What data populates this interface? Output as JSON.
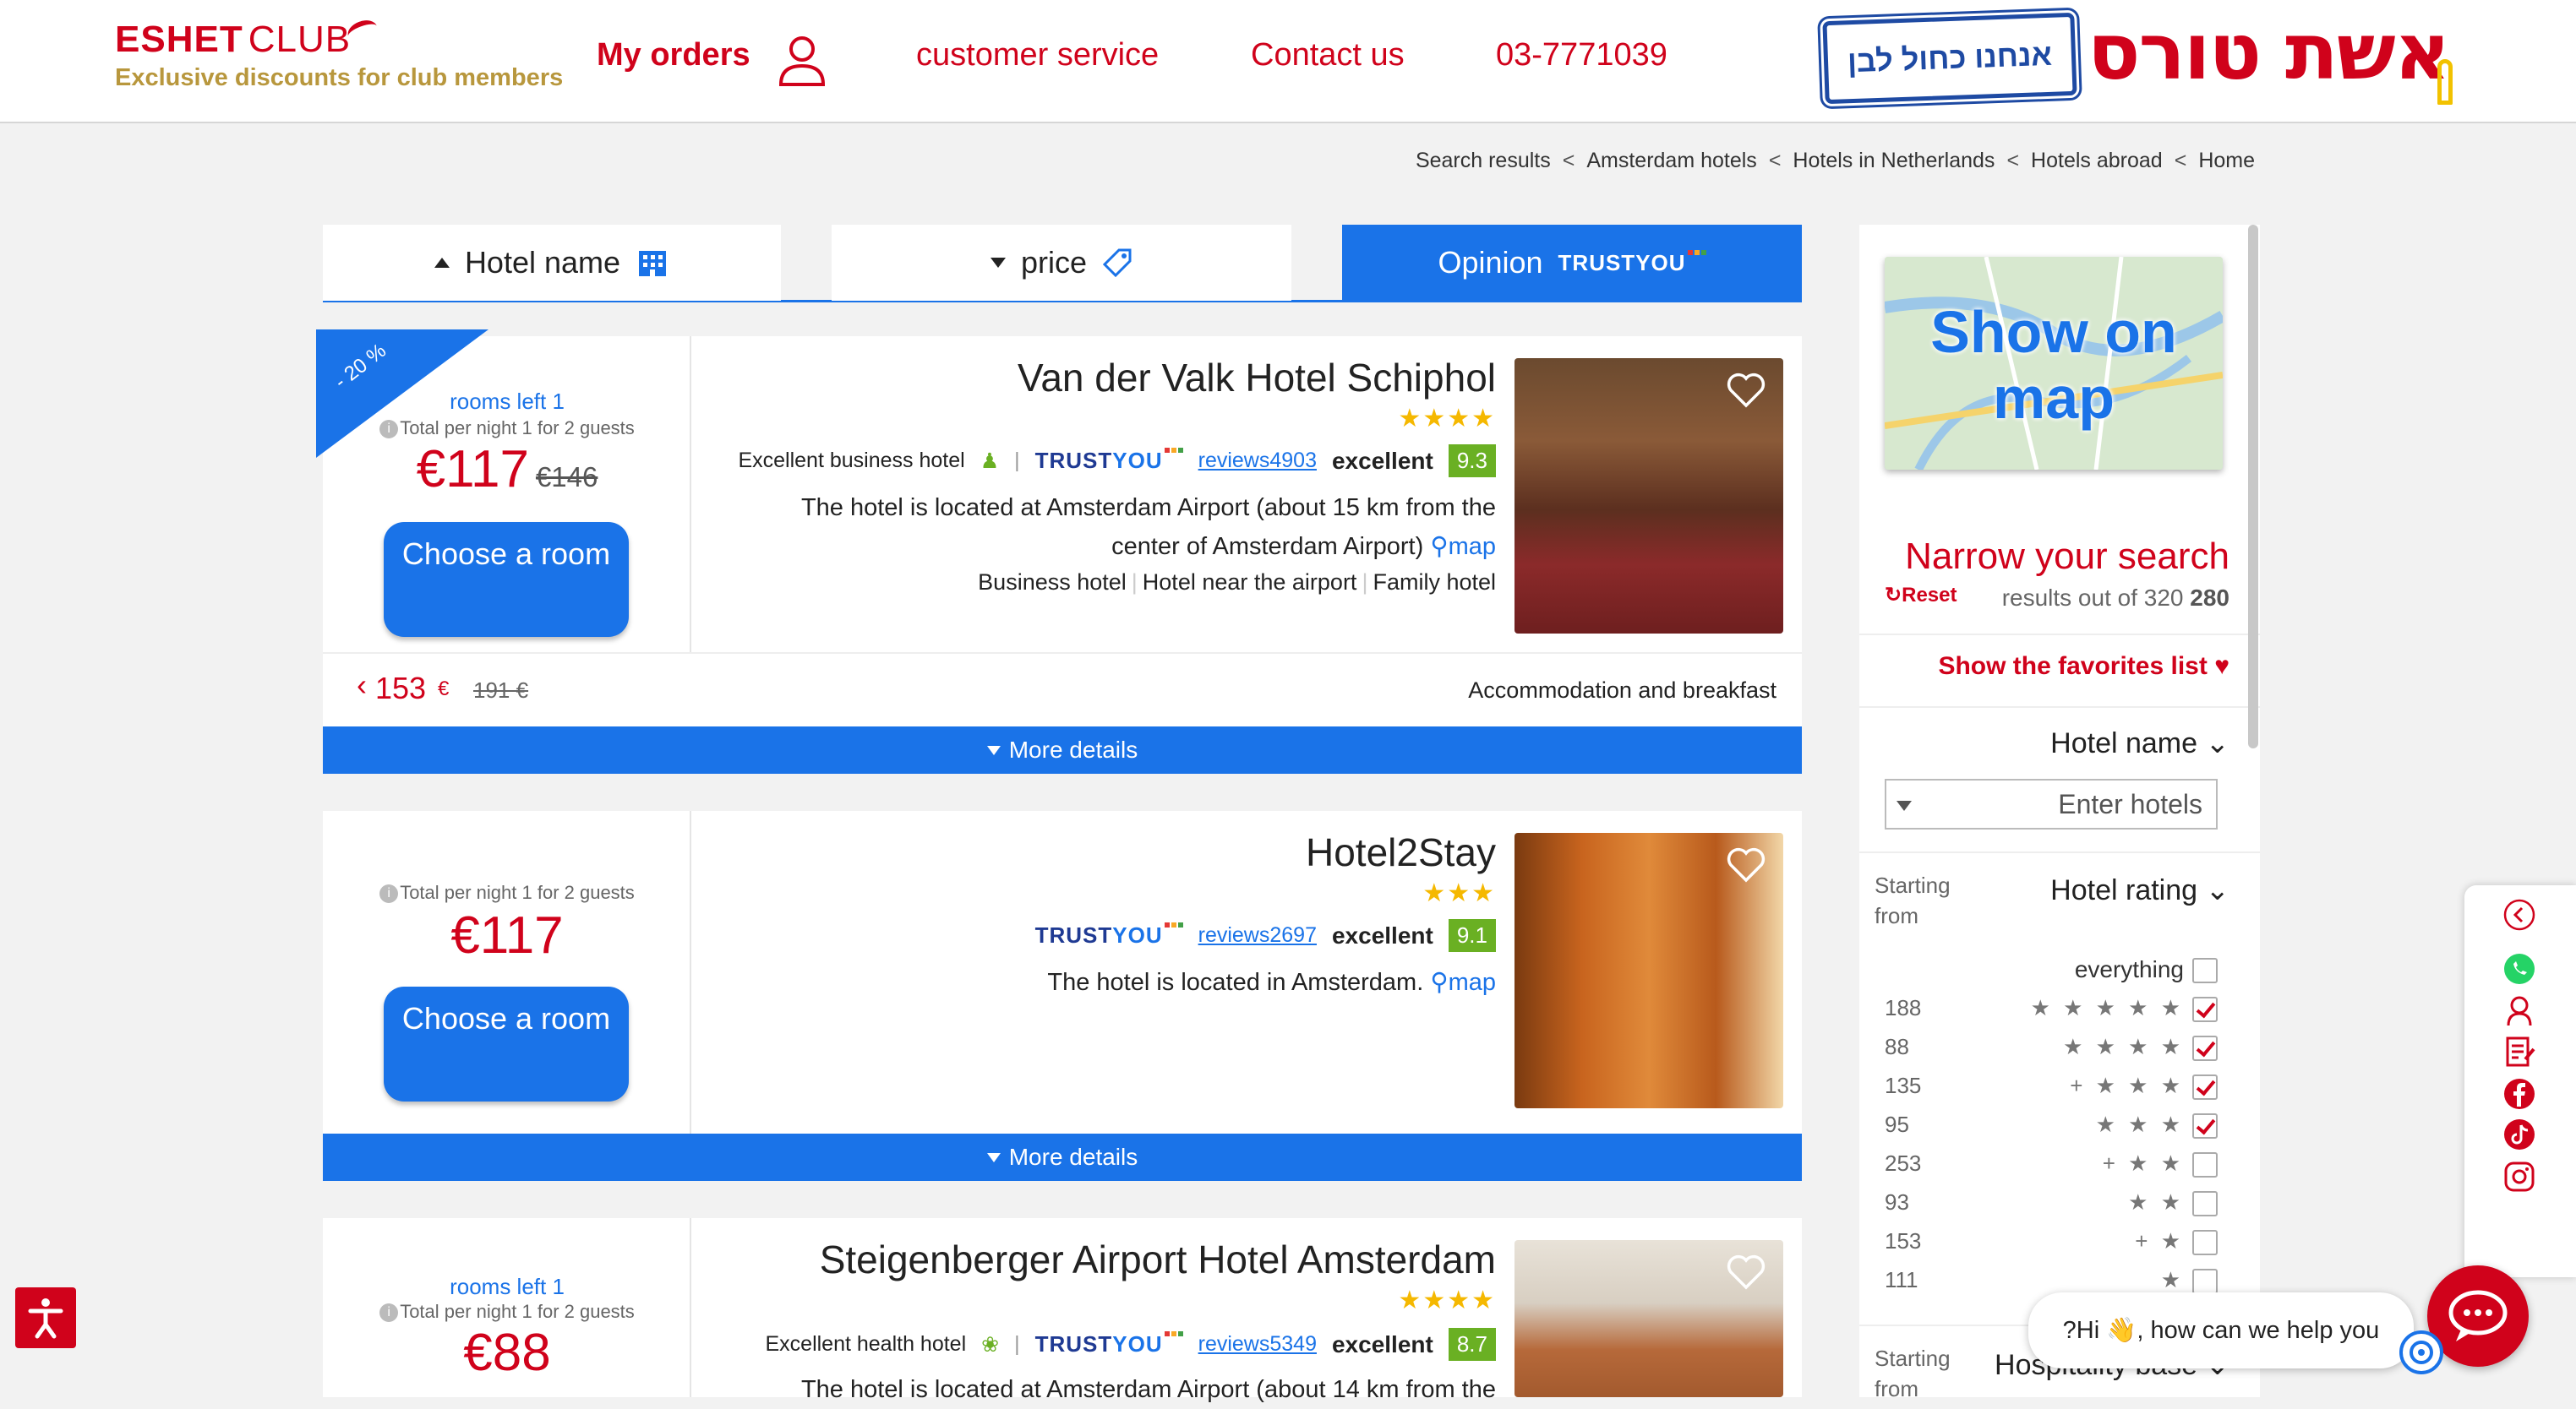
{
  "header": {
    "logo_text_left": "ESHET",
    "logo_text_right": "CLUB",
    "logo_tagline": "Exclusive discounts for club members",
    "my_orders": "My orders",
    "customer_service": "customer service",
    "contact_us": "Contact us",
    "phone": "03-7771039",
    "badge_text": "אנחנו כחול לבן",
    "brand_text": "אשת טורס"
  },
  "breadcrumb": [
    "Search results",
    "Amsterdam hotels",
    "Hotels in Netherlands",
    "Hotels abroad",
    "Home"
  ],
  "sort": {
    "hotel_name": "Hotel name",
    "price": "price",
    "opinion": "Opinion",
    "trust_brand_a": "TRUST",
    "trust_brand_b": "YOU"
  },
  "hotels": [
    {
      "discount": "- 20 %",
      "rooms_left": "rooms left 1",
      "per_night": "Total per night 1 for 2 guests",
      "price": "€117",
      "old_price": "€146",
      "choose_label": "Choose a room",
      "name": "Van der Valk Hotel Schiphol",
      "stars": 4,
      "category": "Excellent business hotel",
      "reviews": "reviews4903",
      "rating_word": "excellent",
      "score": "9.3",
      "description": "The hotel is located at Amsterdam Airport (about 15 km from the center of Amsterdam Airport)",
      "map": "map",
      "tags": [
        "Business hotel",
        "Hotel near the airport",
        "Family hotel"
      ],
      "board_price": "153",
      "board_currency": "€",
      "board_old": "191 €",
      "board_type": "Accommodation and breakfast",
      "more": "More details"
    },
    {
      "per_night": "Total per night 1 for 2 guests",
      "price": "€117",
      "choose_label": "Choose a room",
      "name": "Hotel2Stay",
      "stars": 3,
      "reviews": "reviews2697",
      "rating_word": "excellent",
      "score": "9.1",
      "description": "The hotel is located in Amsterdam.",
      "map": "map",
      "more": "More details"
    },
    {
      "rooms_left": "rooms left 1",
      "per_night": "Total per night 1 for 2 guests",
      "price": "€88",
      "name": "Steigenberger Airport Hotel Amsterdam",
      "stars": 4,
      "category": "Excellent health hotel",
      "reviews": "reviews5349",
      "rating_word": "excellent",
      "score": "8.7",
      "description": "The hotel is located at Amsterdam Airport (about 14 km from the"
    }
  ],
  "sidebar": {
    "show_on_map": "Show on map",
    "narrow_search": "Narrow your search",
    "reset": "Reset",
    "results_prefix": "results out of 320",
    "results_count": "280",
    "favorites": "Show the favorites list",
    "hotel_name_title": "Hotel name",
    "hotel_name_placeholder": "Enter hotels",
    "starting_from": "Starting from",
    "hotel_rating_title": "Hotel rating",
    "everything": "everything",
    "ratings": [
      {
        "count": "188",
        "stars": "★ ★ ★ ★ ★",
        "checked": true
      },
      {
        "count": "88",
        "stars": "★ ★ ★ ★",
        "checked": true
      },
      {
        "count": "135",
        "stars": "+ ★ ★ ★",
        "checked": true
      },
      {
        "count": "95",
        "stars": "★ ★ ★",
        "checked": true
      },
      {
        "count": "253",
        "stars": "+ ★ ★",
        "checked": false
      },
      {
        "count": "93",
        "stars": "★ ★",
        "checked": false
      },
      {
        "count": "153",
        "stars": "+ ★",
        "checked": false
      },
      {
        "count": "111",
        "stars": "★",
        "checked": false
      }
    ],
    "hospitality_title": "Hospitality base"
  },
  "chat": {
    "greeting": "?Hi 👋, how can we help you"
  },
  "colors": {
    "brand_red": "#d0021b",
    "primary_blue": "#1a73e8",
    "score_green": "#6ab023",
    "gold": "#b8973d"
  }
}
